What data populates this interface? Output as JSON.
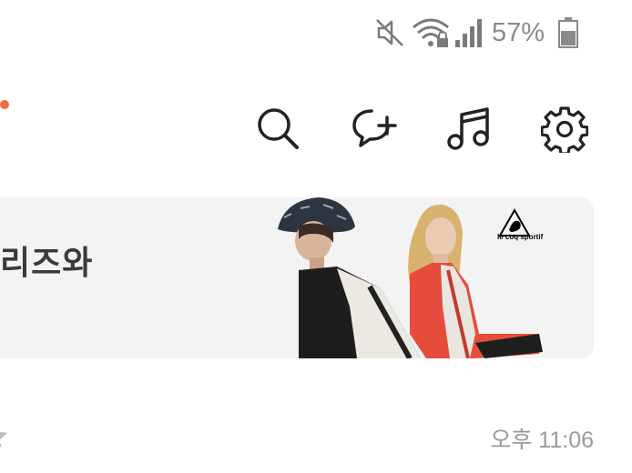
{
  "status_bar": {
    "battery_percent": "57%",
    "icons": [
      "mute-icon",
      "wifi-icon",
      "signal-icon",
      "battery-icon"
    ]
  },
  "toolbar": {
    "icons": [
      "search-icon",
      "add-chat-icon",
      "music-icon",
      "settings-icon"
    ],
    "notification_dot_color": "#f26b3a"
  },
  "banner": {
    "text": "리즈와",
    "brand": "le coq sportif"
  },
  "list_item": {
    "time": "오후 11:06"
  },
  "colors": {
    "accent": "#f26b3a",
    "banner_bg": "#f3f3f3",
    "muted_text": "#9a9a9a"
  }
}
